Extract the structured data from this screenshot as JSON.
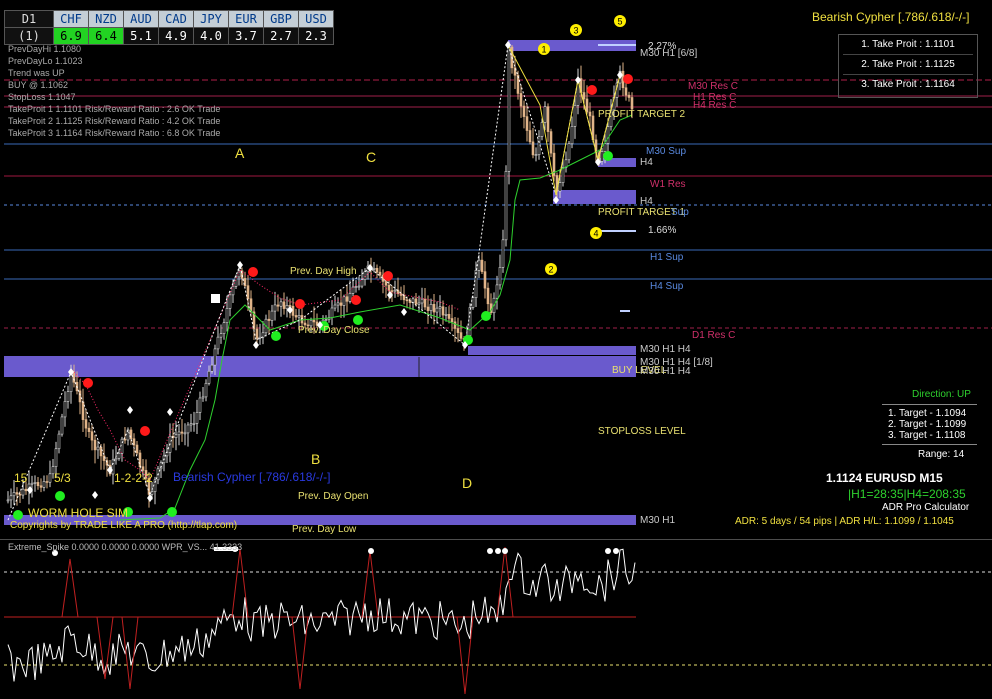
{
  "strength_table": {
    "timeframe": "D1",
    "row_label": "(1)",
    "currencies": [
      "CHF",
      "NZD",
      "AUD",
      "CAD",
      "JPY",
      "EUR",
      "GBP",
      "USD"
    ],
    "values": [
      "6.9",
      "6.4",
      "5.1",
      "4.9",
      "4.0",
      "3.7",
      "2.7",
      "2.3"
    ],
    "highlight_color": "#22d322"
  },
  "info_lines": [
    "PrevDayHi 1.1080",
    "PrevDayLo 1.1023",
    "Trend was UP",
    "BUY @ 1.1062",
    "StopLoss 1.1047",
    "TakeProit 1 1.1101 Risk/Reward Ratio : 2.6 OK Trade",
    "TakeProit 2 1.1125 Risk/Reward Ratio : 4.2 OK Trade",
    "TakeProit 3 1.1164 Risk/Reward Ratio : 6.8 OK Trade"
  ],
  "pattern_title": "Bearish Cypher [.786/.618/-/-]",
  "take_profits": [
    "1. Take Proit : 1.1101",
    "2. Take Proit : 1.1125",
    "3. Take Proit : 1.1164"
  ],
  "pattern_points": [
    "A",
    "B",
    "C",
    "D"
  ],
  "wave_numbers": [
    "1",
    "2",
    "3",
    "4",
    "5"
  ],
  "percent_labels": [
    "2.27%",
    "1.66%"
  ],
  "level_labels": {
    "m30_h1_68": "M30 H1 [6/8]",
    "m30_res": "M30 Res C",
    "h1_res": "H1 Res C",
    "h4_res": "H4 Res C",
    "profit_target_2": "PROFIT TARGET 2",
    "m30_sup": "M30 Sup",
    "h4_a": "H4",
    "w1_res": "W1 Res",
    "h4_b": "H4",
    "profit_target_1": "PROFIT TARGET 1",
    "h4_sup_top": "Sup",
    "h1_sup": "H1 Sup",
    "h4_sup": "H4 Sup",
    "d1_res": "D1 Res C",
    "m30_h1_h4": "M30 H1 H4",
    "m30_h1_h4_18": "M30 H1 H4 [1/8]",
    "buy_level": "BUY LEVEL",
    "m30_h1_h4_c": "M30 H1 H4",
    "stoploss_level": "STOPLOSS LEVEL",
    "m30_h1": "M30 H1",
    "prev_day_high": "Prev. Day High",
    "prev_day_close": "Prev. Day Close",
    "prev_day_open": "Prev. Day Open",
    "prev_day_low": "Prev. Day Low"
  },
  "left_labels": {
    "n15": "15",
    "n53": "5/3",
    "n1222": "1-2-2-2",
    "cypher_small": "Bearish Cypher [.786/.618/-/-]",
    "wormhole": "WORM HOLE SIM",
    "copyright": "Copyrights by TRADE LIKE A PRO (http://tlap.com)"
  },
  "direction_box": {
    "direction": "Direction: UP",
    "targets": [
      "1. Target - 1.1094",
      "2. Target - 1.1099",
      "3. Target - 1.1108"
    ],
    "range": "Range: 14"
  },
  "adr": {
    "price_symbol": "1.1124 EURUSD M15",
    "hours": "|H1=28:35|H4=208:35",
    "calc": "ADR Pro Calculator",
    "days": "ADR: 5 days / 54 pips | ADR H/L: 1.1099 / 1.1045"
  },
  "indicator": {
    "header": "Extreme_Spike 0.0000 0.0000 0.0000  WPR_VS... 41.3333"
  },
  "colors": {
    "bg": "#000000",
    "zone": "#6a5acd",
    "resistance": "#c0205a",
    "support": "#3a6ab8",
    "supertrend": "#2ed12e",
    "candle_up": "#d7d7d7",
    "candle_down": "#e0b489",
    "pattern": "#f0e040"
  }
}
